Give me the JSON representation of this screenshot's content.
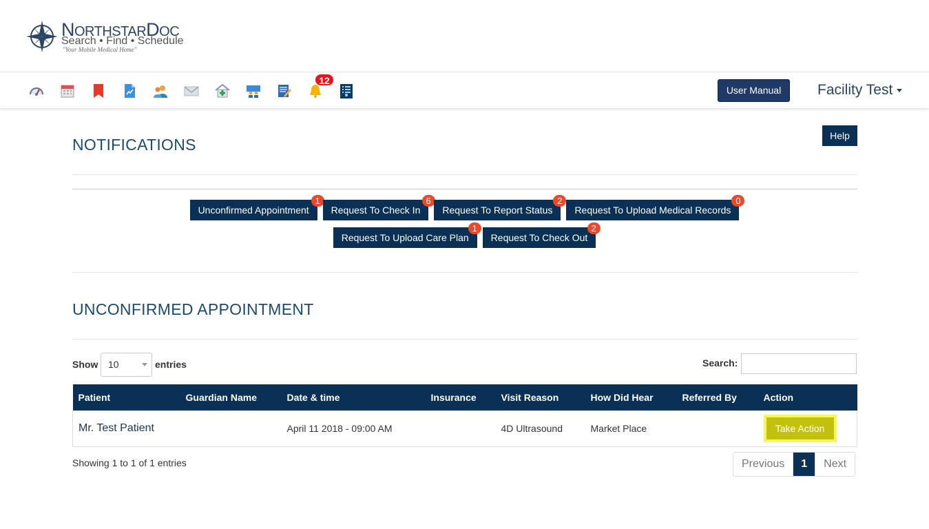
{
  "brand": {
    "name_first_letter": "N",
    "name_rest_1": "ORTHSTAR",
    "name_letter_2": "D",
    "name_rest_2": "OC",
    "subtitle": "Search • Find • Schedule",
    "tagline": "\"Your Mobile Medical Home\""
  },
  "nav": {
    "icons": [
      "dashboard-icon",
      "calendar-icon",
      "bookmark-icon",
      "report-icon",
      "users-icon",
      "mail-icon",
      "clinic-icon",
      "family-icon",
      "notes-icon",
      "bell-icon",
      "directory-icon"
    ],
    "notification_count": "12",
    "user_manual_label": "User Manual",
    "facility_name": "Facility Test"
  },
  "help_label": "Help",
  "notifications": {
    "title": "NOTIFICATIONS",
    "buttons": [
      {
        "label": "Unconfirmed Appointment",
        "count": "1"
      },
      {
        "label": "Request To Check In",
        "count": "6"
      },
      {
        "label": "Request To Report Status",
        "count": "2"
      },
      {
        "label": "Request To Upload Medical Records",
        "count": "0"
      },
      {
        "label": "Request To Upload Care Plan",
        "count": "1"
      },
      {
        "label": "Request To Check Out",
        "count": "2"
      }
    ]
  },
  "unconfirmed": {
    "title": "UNCONFIRMED APPOINTMENT",
    "show_label": "Show",
    "page_length": "10",
    "entries_label": "entries",
    "search_label": "Search:",
    "search_value": "",
    "columns": [
      "Patient",
      "Guardian Name",
      "Date & time",
      "Insurance",
      "Visit Reason",
      "How Did Hear",
      "Referred By",
      "Action"
    ],
    "rows": [
      {
        "patient": "Mr. Test Patient",
        "guardian": "",
        "datetime": "April 11 2018 - 09:00 AM",
        "insurance": "",
        "visit_reason": "4D Ultrasound",
        "how_did_hear": "Market Place",
        "referred_by": "",
        "action_label": "Take Action"
      }
    ],
    "info": "Showing 1 to 1 of 1 entries",
    "pagination": {
      "previous": "Previous",
      "current": "1",
      "next": "Next"
    }
  },
  "colors": {
    "navy": "#0a3055",
    "badge": "#e84a2c",
    "alert": "#e8141b",
    "action": "#c2c20e",
    "title": "#1e4a72"
  }
}
